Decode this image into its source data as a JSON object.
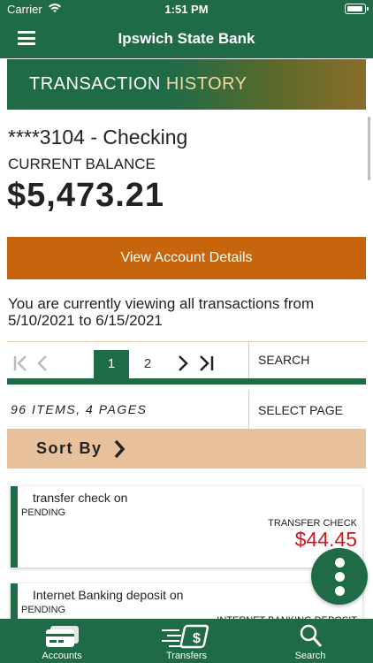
{
  "status_bar": {
    "carrier": "Carrier",
    "time": "1:51 PM"
  },
  "header": {
    "title": "Ipswich State Bank"
  },
  "banner": {
    "title_part1": "TRANSACTION ",
    "title_part2": "HISTORY"
  },
  "account": {
    "name": "****3104 - Checking",
    "balance_label": "CURRENT BALANCE",
    "balance": "$5,473.21"
  },
  "view_details_label": "View Account Details",
  "viewing_text": "You are currently viewing all transactions from 5/10/2021 to 6/15/2021",
  "pagination": {
    "first": "K",
    "prev": "<",
    "pages": [
      "1",
      "2"
    ],
    "next": ">",
    "last": ">I",
    "search_label": "SEARCH"
  },
  "items_summary": "96 ITEMS, 4 PAGES",
  "select_page_label": "SELECT PAGE",
  "sort_by_label": "Sort By",
  "transactions": [
    {
      "description": "transfer check on",
      "status": "PENDING",
      "type": "TRANSFER CHECK",
      "amount": "$44.45"
    },
    {
      "description": "Internet Banking deposit on",
      "status": "PENDING",
      "type": "INTERNET BANKING DEPOSIT",
      "amount": ""
    }
  ],
  "tabs": [
    {
      "label": "Accounts",
      "icon": "credit-card-icon"
    },
    {
      "label": "Transfers",
      "icon": "money-transfer-icon"
    },
    {
      "label": "Search",
      "icon": "search-icon"
    }
  ],
  "colors": {
    "brand_green": "#1f6b48",
    "accent_orange": "#c6650d",
    "sort_bar": "#e8c19c",
    "amount_red": "#d0181e"
  }
}
